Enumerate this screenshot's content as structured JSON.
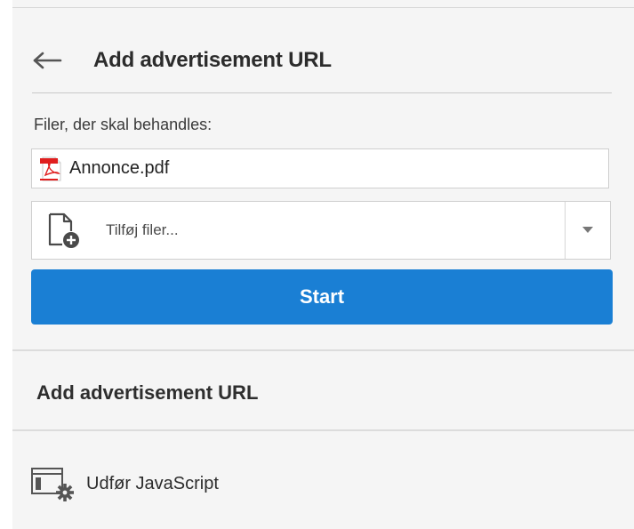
{
  "header": {
    "title": "Add advertisement URL",
    "back_icon": "back-arrow-icon"
  },
  "files": {
    "label": "Filer, der skal behandles:",
    "items": [
      {
        "name": "Annonce.pdf",
        "icon": "pdf-file-icon"
      }
    ],
    "add_label": "Tilføj filer...",
    "add_icon": "add-file-icon",
    "dropdown_icon": "caret-down-icon"
  },
  "start_button": {
    "label": "Start",
    "color": "#1a7fd4"
  },
  "section": {
    "title": "Add advertisement URL",
    "actions": [
      {
        "label": "Udfør JavaScript",
        "icon": "execute-javascript-icon"
      }
    ]
  }
}
